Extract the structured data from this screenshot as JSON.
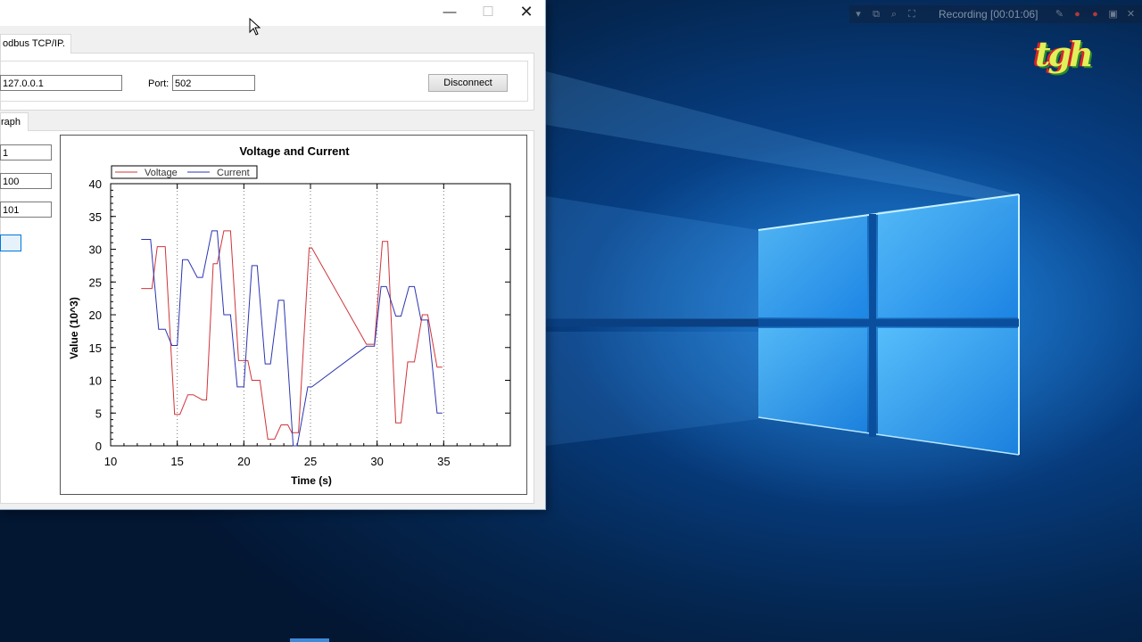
{
  "window": {
    "controls": {
      "minimize": "—",
      "maximize": "☐",
      "close": "✕"
    },
    "tab_connection": "odbus TCP/IP.",
    "ip_value": "127.0.0.1",
    "port_label": "Port:",
    "port_value": "502",
    "disconnect_label": "Disconnect",
    "tab_graph": "raph",
    "field1_value": "1",
    "field2_value": "100",
    "field3_value": "101"
  },
  "recorder": {
    "status_text": "Recording [00:01:06]"
  },
  "desktop": {
    "logo_text": "tgh"
  },
  "colors": {
    "voltage": "#d0343a",
    "current": "#2b35b0"
  },
  "chart_data": {
    "type": "line",
    "title": "Voltage and Current",
    "xlabel": "Time (s)",
    "ylabel": "Value (10^3)",
    "xlim": [
      10,
      40
    ],
    "ylim": [
      0,
      40
    ],
    "xticks": [
      10,
      15,
      20,
      25,
      30,
      35
    ],
    "yticks": [
      0,
      5,
      10,
      15,
      20,
      25,
      30,
      35,
      40
    ],
    "grid_x_dotted": [
      15,
      20,
      25,
      30,
      35
    ],
    "legend_position": "top-left",
    "series": [
      {
        "name": "Voltage",
        "color": "#d0343a",
        "points": [
          [
            12.3,
            24
          ],
          [
            13.1,
            24
          ],
          [
            13.5,
            30.4
          ],
          [
            14.1,
            30.4
          ],
          [
            14.8,
            4.8
          ],
          [
            15.2,
            4.8
          ],
          [
            15.8,
            7.8
          ],
          [
            16.2,
            7.8
          ],
          [
            16.9,
            7
          ],
          [
            17.2,
            7
          ],
          [
            17.7,
            27.8
          ],
          [
            18,
            27.8
          ],
          [
            18.5,
            32.8
          ],
          [
            19,
            32.8
          ],
          [
            19.6,
            13
          ],
          [
            20,
            13
          ],
          [
            20.3,
            13
          ],
          [
            20.6,
            10
          ],
          [
            21.2,
            10
          ],
          [
            21.8,
            1
          ],
          [
            22.3,
            1
          ],
          [
            22.8,
            3.2
          ],
          [
            23.3,
            3.2
          ],
          [
            23.6,
            2
          ],
          [
            24.1,
            2
          ],
          [
            24.9,
            30.2
          ],
          [
            25.1,
            30.2
          ],
          [
            29.2,
            15.5
          ],
          [
            29.8,
            15.5
          ],
          [
            30.4,
            31.2
          ],
          [
            30.8,
            31.2
          ],
          [
            31.4,
            3.5
          ],
          [
            31.8,
            3.5
          ],
          [
            32.3,
            12.8
          ],
          [
            32.8,
            12.8
          ],
          [
            33.4,
            20
          ],
          [
            33.8,
            20
          ],
          [
            34.5,
            12
          ],
          [
            34.9,
            12
          ]
        ]
      },
      {
        "name": "Current",
        "color": "#2b35b0",
        "points": [
          [
            12.3,
            31.5
          ],
          [
            13,
            31.5
          ],
          [
            13.6,
            17.8
          ],
          [
            14.1,
            17.8
          ],
          [
            14.6,
            15.3
          ],
          [
            15,
            15.3
          ],
          [
            15.4,
            28.4
          ],
          [
            15.8,
            28.4
          ],
          [
            16.5,
            25.7
          ],
          [
            16.9,
            25.7
          ],
          [
            17.6,
            32.8
          ],
          [
            18,
            32.8
          ],
          [
            18.5,
            20
          ],
          [
            19,
            20
          ],
          [
            19.5,
            9
          ],
          [
            20,
            9
          ],
          [
            20.6,
            27.5
          ],
          [
            21,
            27.5
          ],
          [
            21.6,
            12.5
          ],
          [
            22,
            12.5
          ],
          [
            22.6,
            22.2
          ],
          [
            23,
            22.2
          ],
          [
            23.7,
            0
          ],
          [
            24,
            0
          ],
          [
            24.8,
            9
          ],
          [
            25.1,
            9
          ],
          [
            29.2,
            15.2
          ],
          [
            29.8,
            15.2
          ],
          [
            30.3,
            24.3
          ],
          [
            30.7,
            24.3
          ],
          [
            31.4,
            19.8
          ],
          [
            31.8,
            19.8
          ],
          [
            32.4,
            24.3
          ],
          [
            32.8,
            24.3
          ],
          [
            33.3,
            19.2
          ],
          [
            33.8,
            19.2
          ],
          [
            34.5,
            5
          ],
          [
            34.9,
            5
          ]
        ]
      }
    ]
  }
}
